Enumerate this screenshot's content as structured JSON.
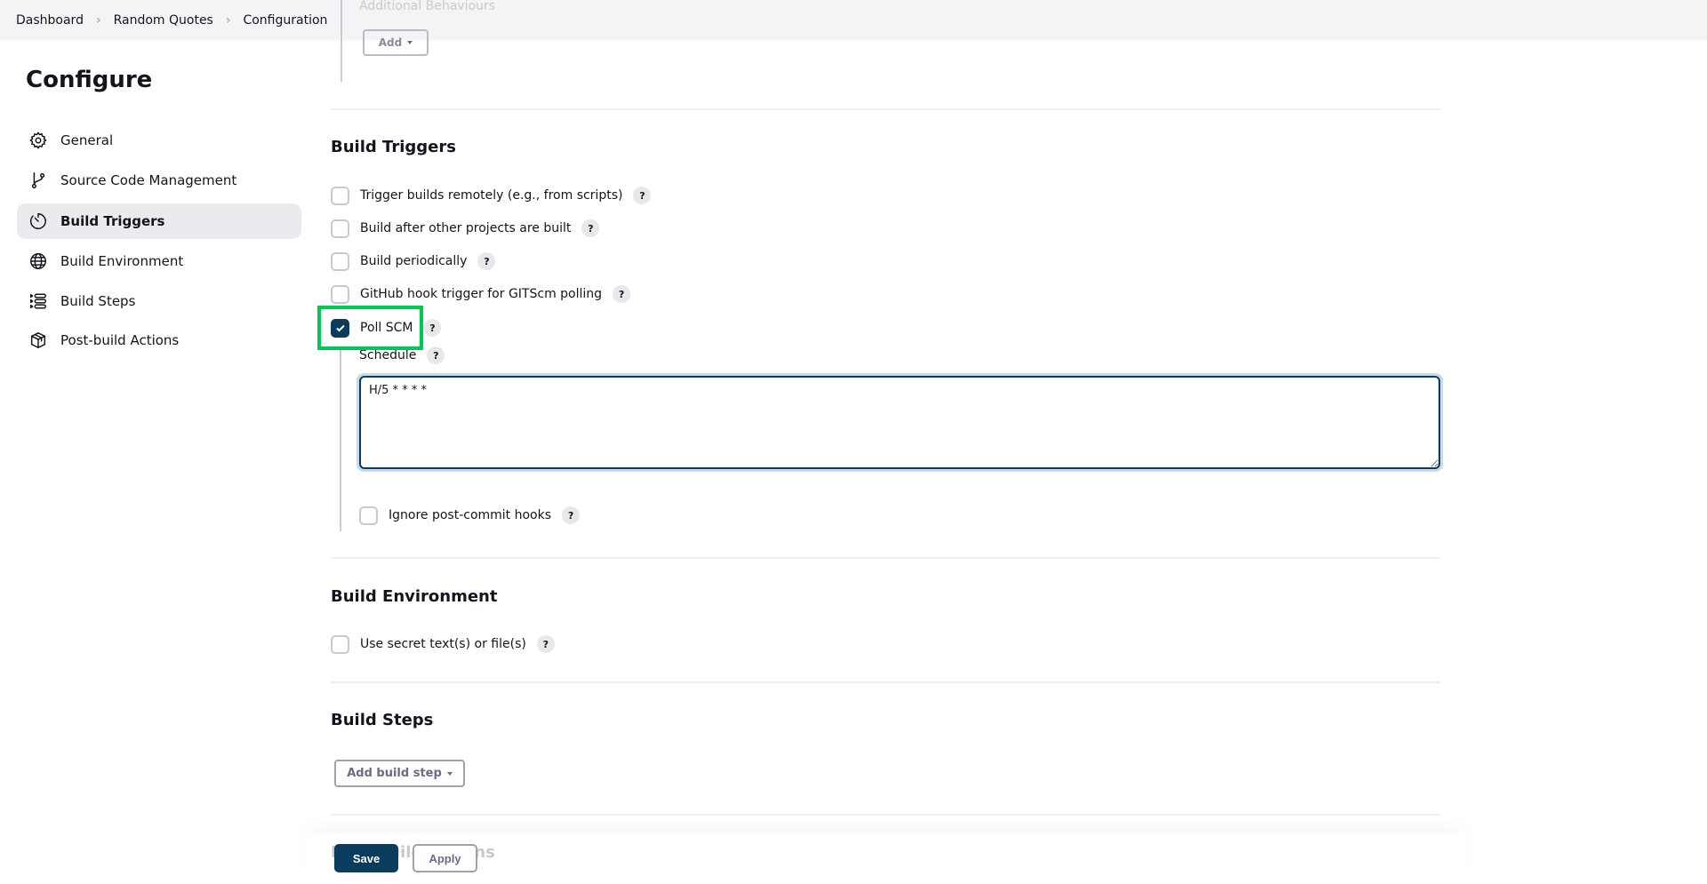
{
  "breadcrumb": {
    "items": [
      "Dashboard",
      "Random Quotes",
      "Configuration"
    ],
    "separator": ">"
  },
  "previous_section": {
    "label": "Additional Behaviours",
    "add_button": "Add"
  },
  "sidebar": {
    "title": "Configure",
    "items": [
      {
        "label": "General",
        "icon": "gear-icon",
        "active": false
      },
      {
        "label": "Source Code Management",
        "icon": "git-branch-icon",
        "active": false
      },
      {
        "label": "Build Triggers",
        "icon": "timer-icon",
        "active": true
      },
      {
        "label": "Build Environment",
        "icon": "globe-icon",
        "active": false
      },
      {
        "label": "Build Steps",
        "icon": "steps-list-icon",
        "active": false
      },
      {
        "label": "Post-build Actions",
        "icon": "package-icon",
        "active": false
      }
    ]
  },
  "build_triggers": {
    "heading": "Build Triggers",
    "options": [
      {
        "label": "Trigger builds remotely (e.g., from scripts)",
        "checked": false
      },
      {
        "label": "Build after other projects are built",
        "checked": false
      },
      {
        "label": "Build periodically",
        "checked": false
      },
      {
        "label": "GitHub hook trigger for GITScm polling",
        "checked": false
      },
      {
        "label": "Poll SCM",
        "checked": true
      }
    ],
    "poll_scm": {
      "schedule_label": "Schedule",
      "schedule_value": "H/5 * * * *",
      "ignore_hooks_label": "Ignore post-commit hooks",
      "ignore_hooks_checked": false
    }
  },
  "build_environment": {
    "heading": "Build Environment",
    "options": [
      {
        "label": "Use secret text(s) or file(s)",
        "checked": false
      }
    ]
  },
  "build_steps": {
    "heading": "Build Steps",
    "add_button": "Add build step"
  },
  "post_build": {
    "heading": "Post-build Actions"
  },
  "footer": {
    "save": "Save",
    "apply": "Apply"
  },
  "help_glyph": "?",
  "colors": {
    "primary": "#0b3c5d",
    "highlight": "#00c853",
    "focus_ring": "#c6dcec",
    "active_nav_bg": "#ebebef"
  }
}
